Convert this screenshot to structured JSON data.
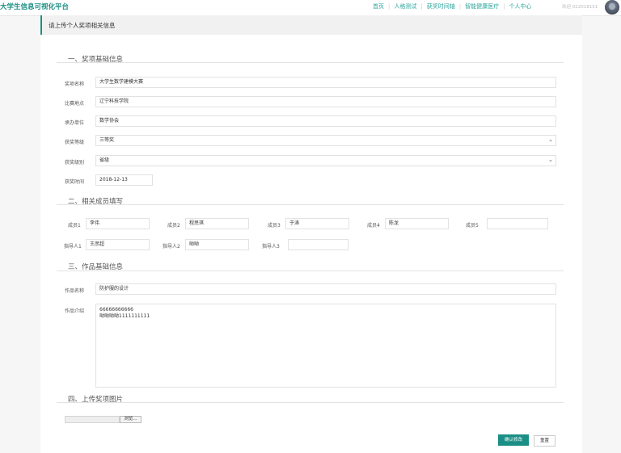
{
  "app": {
    "title": "大学生信息可视化平台"
  },
  "nav": {
    "items": [
      "首页",
      "人格测试",
      "获奖时间轴",
      "智能健康医疗",
      "个人中心"
    ],
    "welcome": "欢迎 022018151"
  },
  "page": {
    "heading": "请上传个人奖项相关信息"
  },
  "section1": {
    "title": "一、奖项基础信息",
    "award_name_label": "奖项名称",
    "award_name_value": "大学生数学建模大赛",
    "venue_label": "比赛地点",
    "venue_value": "辽宁科技学院",
    "organizer_label": "承办单位",
    "organizer_value": "数学协会",
    "grade_label": "获奖等级",
    "grade_value": "三等奖",
    "level_label": "获奖级别",
    "level_value": "省级",
    "date_label": "获奖时间",
    "date_value": "2018-12-13"
  },
  "section2": {
    "title": "二、相关成员填写",
    "members": [
      {
        "label": "成员1",
        "value": "李伟"
      },
      {
        "label": "成员2",
        "value": "程思琪"
      },
      {
        "label": "成员3",
        "value": "于涛"
      },
      {
        "label": "成员4",
        "value": "陈龙"
      },
      {
        "label": "成员5",
        "value": ""
      }
    ],
    "mentors": [
      {
        "label": "指导人1",
        "value": "王彦超"
      },
      {
        "label": "指导人2",
        "value": "呦呦"
      },
      {
        "label": "指导人3",
        "value": ""
      }
    ]
  },
  "section3": {
    "title": "三、作品基础信息",
    "work_name_label": "作品名称",
    "work_name_value": "防护服的设计",
    "work_intro_label": "作品介绍",
    "work_intro_value": "66666666666\n呦呦呦呦1111111111"
  },
  "section4": {
    "title": "四、上传奖项图片",
    "browse_label": "浏览..."
  },
  "actions": {
    "confirm_label": "确认修改",
    "reset_label": "重置"
  },
  "colors": {
    "accent": "#1b8f86",
    "nav": "#2aa59c"
  }
}
